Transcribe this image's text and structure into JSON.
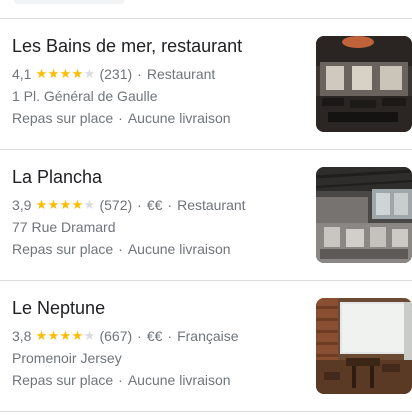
{
  "results": [
    {
      "name": "Les Bains de mer, restaurant",
      "rating": "4,1",
      "stars": 4.1,
      "reviews": "(231)",
      "price": "",
      "category": "Restaurant",
      "address": "1 Pl. Général de Gaulle",
      "options": [
        "Repas sur place",
        "Aucune livraison"
      ],
      "photo_icon": "restaurant-interior-photo"
    },
    {
      "name": "La Plancha",
      "rating": "3,9",
      "stars": 3.9,
      "reviews": "(572)",
      "price": "€€",
      "category": "Restaurant",
      "address": "77 Rue Dramard",
      "options": [
        "Repas sur place",
        "Aucune livraison"
      ],
      "photo_icon": "restaurant-interior-photo"
    },
    {
      "name": "Le Neptune",
      "rating": "3,8",
      "stars": 3.8,
      "reviews": "(667)",
      "price": "€€",
      "category": "Française",
      "address": "Promenoir Jersey",
      "options": [
        "Repas sur place",
        "Aucune livraison"
      ],
      "photo_icon": "restaurant-interior-photo"
    }
  ],
  "colors": {
    "star_on": "#fbbc04",
    "star_off": "#dadce0",
    "secondary_text": "#70757a",
    "primary_text": "#202124",
    "divider": "#dadce0"
  }
}
